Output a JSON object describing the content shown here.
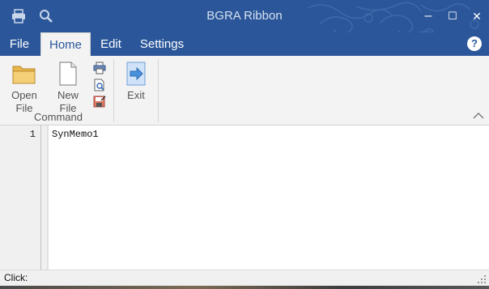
{
  "titlebar": {
    "title": "BGRA Ribbon",
    "qat_icons": [
      "printer-icon",
      "search-icon"
    ],
    "minimize": "–",
    "maximize": "☐",
    "close": "✕"
  },
  "tabs": [
    {
      "label": "File",
      "active": false
    },
    {
      "label": "Home",
      "active": true
    },
    {
      "label": "Edit",
      "active": false
    },
    {
      "label": "Settings",
      "active": false
    }
  ],
  "help_label": "?",
  "ribbon": {
    "group_label": "Command",
    "open_line1": "Open",
    "open_line2": "File",
    "new_line1": "New",
    "new_line2": "File",
    "exit_label": "Exit",
    "small_icons": [
      "printer-icon",
      "print-preview-icon",
      "save-icon"
    ]
  },
  "editor": {
    "line_number": "1",
    "text": "SynMemo1"
  },
  "status": {
    "text": "Click:"
  },
  "colors": {
    "accent": "#2b579a",
    "ribbon_bg": "#f3f3f3",
    "gutter_bg": "#f0f0f0"
  }
}
